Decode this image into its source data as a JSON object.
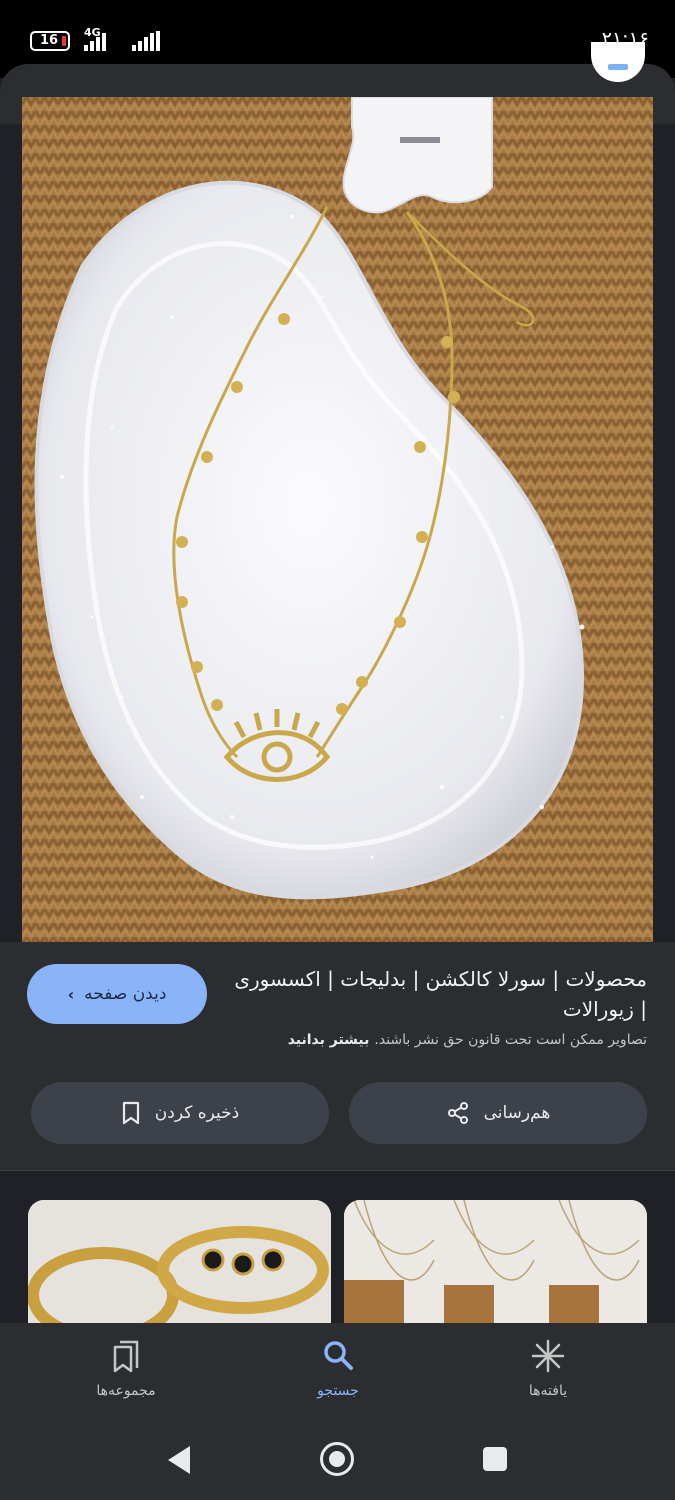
{
  "status_bar": {
    "time": "۲۱:۱۶",
    "battery": "16",
    "network": "4G"
  },
  "image_preview": {
    "title": "محصولات | سورلا کالکشن | بدلیجات | اکسسوری | زیورالات",
    "visit_label": "دیدن صفحه",
    "copyright_notice": "تصاویر ممکن است تحت قانون حق نشر باشند.",
    "learn_more": "بیشتر بدانید",
    "share_label": "هم‌رسانی",
    "save_label": "ذخیره کردن"
  },
  "bottom_nav": {
    "collections": "مجموعه‌ها",
    "search": "جستجو",
    "discover": "یافته‌ها",
    "active": "search"
  },
  "colors": {
    "accent": "#8ab4f8",
    "panel": "#2b2d31",
    "button": "#3c414a"
  }
}
